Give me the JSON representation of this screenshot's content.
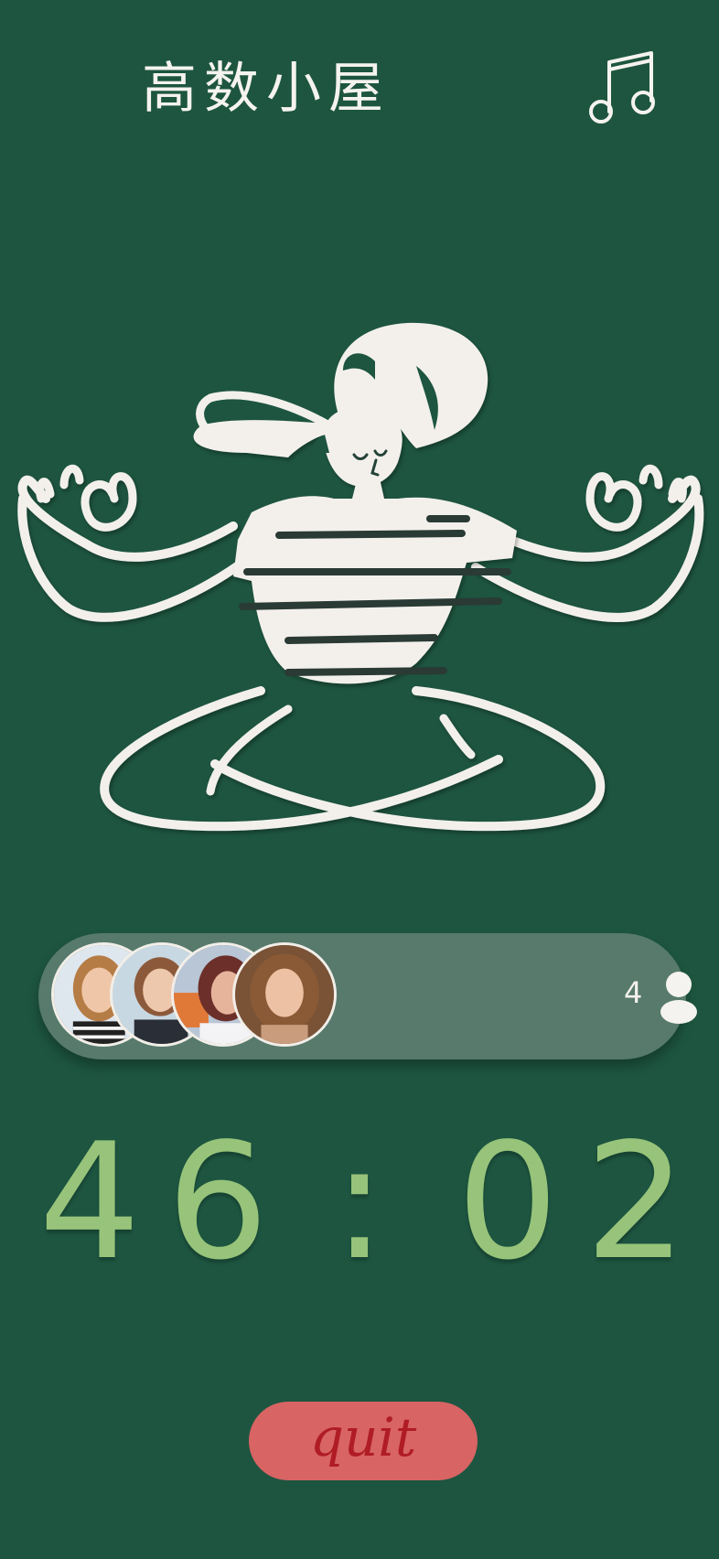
{
  "header": {
    "title": "高数小屋",
    "music_icon": "music-note-icon"
  },
  "colors": {
    "background": "#1d5540",
    "pill": "#577a6c",
    "timer": "#97c47a",
    "quit_button": "#d86464",
    "quit_text": "#b01c24"
  },
  "illustration": {
    "icon": "meditating-person-illustration"
  },
  "room": {
    "member_count": "4",
    "member_icon": "person-icon",
    "avatars": [
      {
        "name": "avatar-1"
      },
      {
        "name": "avatar-2"
      },
      {
        "name": "avatar-3"
      },
      {
        "name": "avatar-4"
      }
    ]
  },
  "timer": {
    "minutes_tens": "4",
    "minutes_ones": "6",
    "separator": ":",
    "seconds_tens": "0",
    "seconds_ones": "2"
  },
  "actions": {
    "quit_label": "quit"
  }
}
